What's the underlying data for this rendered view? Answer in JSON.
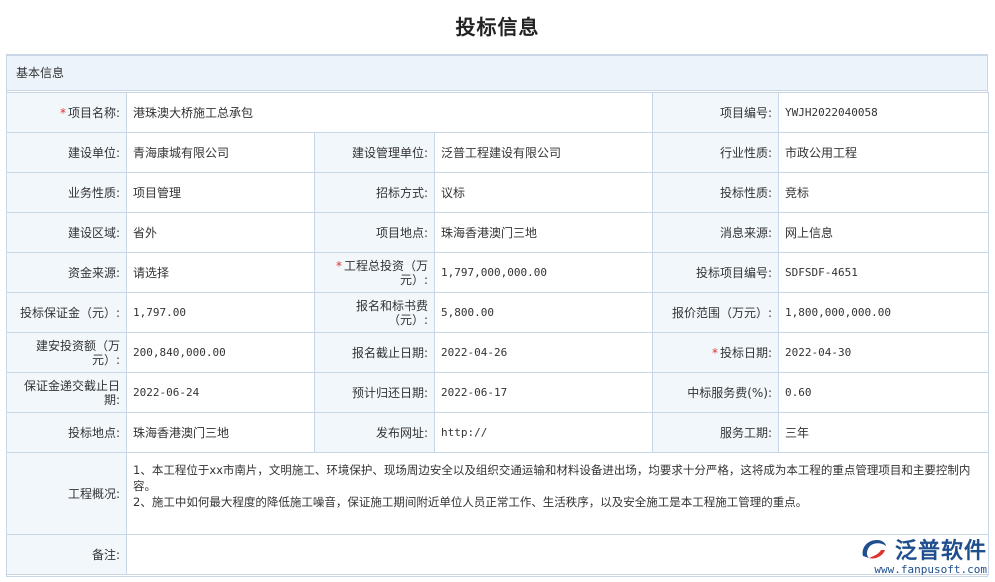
{
  "title": "投标信息",
  "section": "基本信息",
  "rows": [
    [
      {
        "label": "项目名称:",
        "required": true,
        "value": "港珠澳大桥施工总承包",
        "colspan": 3
      },
      {
        "label": "项目编号:",
        "value": "YWJH2022040058"
      }
    ],
    [
      {
        "label": "建设单位:",
        "value": "青海康城有限公司"
      },
      {
        "label": "建设管理单位:",
        "value": "泛普工程建设有限公司"
      },
      {
        "label": "行业性质:",
        "value": "市政公用工程"
      }
    ],
    [
      {
        "label": "业务性质:",
        "value": "项目管理"
      },
      {
        "label": "招标方式:",
        "value": "议标"
      },
      {
        "label": "投标性质:",
        "value": "竞标"
      }
    ],
    [
      {
        "label": "建设区域:",
        "value": "省外"
      },
      {
        "label": "项目地点:",
        "value": "珠海香港澳门三地"
      },
      {
        "label": "消息来源:",
        "value": "网上信息"
      }
    ],
    [
      {
        "label": "资金来源:",
        "value": "请选择"
      },
      {
        "label": "工程总投资（万元）:",
        "required": true,
        "value": "1,797,000,000.00"
      },
      {
        "label": "投标项目编号:",
        "value": "SDFSDF-4651"
      }
    ],
    [
      {
        "label": "投标保证金（元）:",
        "value": "1,797.00"
      },
      {
        "label": "报名和标书费（元）:",
        "value": "5,800.00"
      },
      {
        "label": "报价范围（万元）:",
        "value": "1,800,000,000.00"
      }
    ],
    [
      {
        "label": "建安投资额（万元）:",
        "value": "200,840,000.00"
      },
      {
        "label": "报名截止日期:",
        "value": "2022-04-26"
      },
      {
        "label": "投标日期:",
        "required": true,
        "value": "2022-04-30"
      }
    ],
    [
      {
        "label": "保证金递交截止日期:",
        "value": "2022-06-24"
      },
      {
        "label": "预计归还日期:",
        "value": "2022-06-17"
      },
      {
        "label": "中标服务费(%):",
        "value": "0.60"
      }
    ],
    [
      {
        "label": "投标地点:",
        "value": "珠海香港澳门三地"
      },
      {
        "label": "发布网址:",
        "value": "http://"
      },
      {
        "label": "服务工期:",
        "value": "三年"
      }
    ]
  ],
  "overview": {
    "label": "工程概况:",
    "line1": "1、本工程位于xx市南片，文明施工、环境保护、现场周边安全以及组织交通运输和材料设备进出场，均要求十分严格，这将成为本工程的重点管理项目和主要控制内容。",
    "line2": "2、施工中如何最大程度的降低施工噪音，保证施工期间附近单位人员正常工作、生活秩序，以及安全施工是本工程施工管理的重点。"
  },
  "remark": {
    "label": "备注:",
    "value": ""
  },
  "watermark": {
    "name": "泛普软件",
    "url": "www.fanpusoft.com"
  },
  "colors": {
    "border": "#c8d6e6",
    "label_bg": "#f2f7fc",
    "header_bg": "#ecf3fb",
    "required": "#e0312f",
    "brand": "#1f4f8f"
  }
}
